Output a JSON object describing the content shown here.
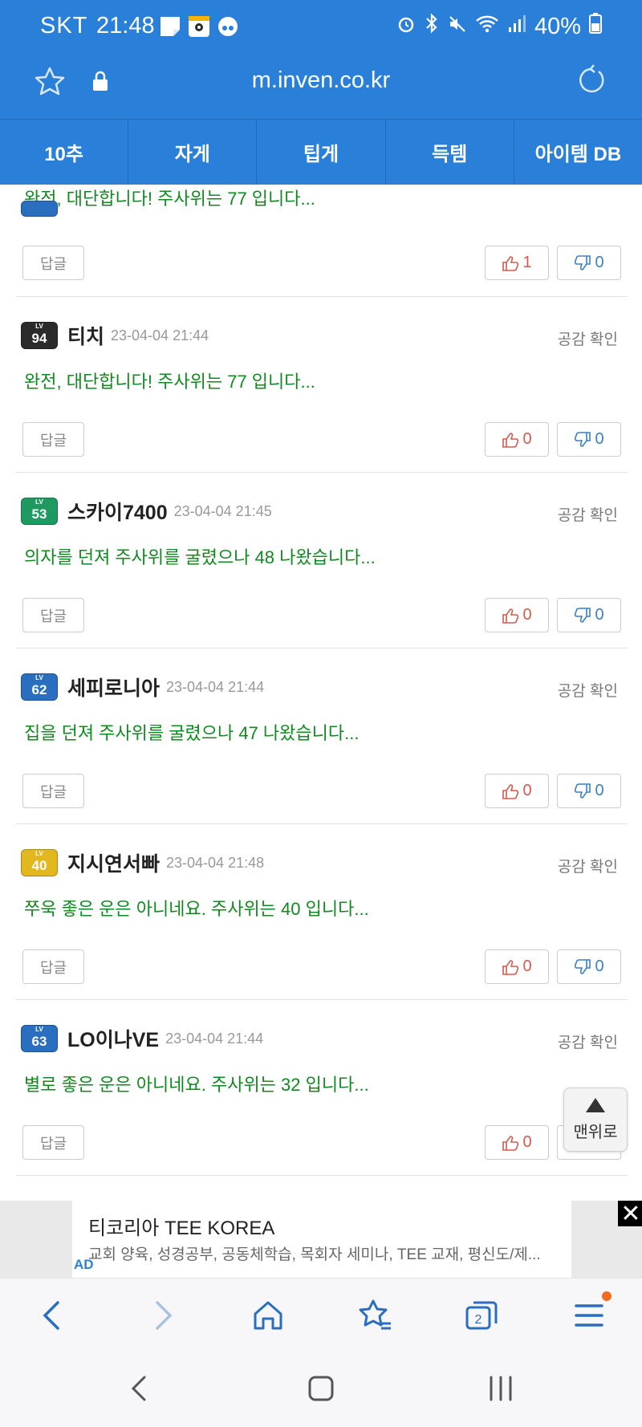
{
  "status": {
    "carrier": "SKT",
    "time": "21:48",
    "battery": "40%"
  },
  "browser": {
    "url": "m.inven.co.kr"
  },
  "tabs": [
    {
      "label": "10추"
    },
    {
      "label": "자게"
    },
    {
      "label": "팁게"
    },
    {
      "label": "득템"
    },
    {
      "label": "아이템 DB"
    }
  ],
  "comments": [
    {
      "text": "완전, 대단합니다! 주사위는 77 입니다...",
      "reply": "답글",
      "up": "1",
      "down": "0",
      "partial": true
    },
    {
      "level": "94",
      "badge_color": "#2b2b2b",
      "nick": "티치",
      "date": "23-04-04 21:44",
      "empathy": "공감 확인",
      "text": "완전, 대단합니다! 주사위는 77 입니다...",
      "reply": "답글",
      "up": "0",
      "down": "0"
    },
    {
      "level": "53",
      "badge_color": "#1e9a61",
      "nick": "스카이7400",
      "date": "23-04-04 21:45",
      "empathy": "공감 확인",
      "text": "의자를 던져 주사위를 굴렸으나 48 나왔습니다...",
      "reply": "답글",
      "up": "0",
      "down": "0"
    },
    {
      "level": "62",
      "badge_color": "#2a6fbf",
      "nick": "세피로니아",
      "date": "23-04-04 21:44",
      "empathy": "공감 확인",
      "text": "집을 던져 주사위를 굴렸으나 47 나왔습니다...",
      "reply": "답글",
      "up": "0",
      "down": "0"
    },
    {
      "level": "40",
      "badge_color": "#e3b81f",
      "nick": "지시연서빠",
      "date": "23-04-04 21:48",
      "empathy": "공감 확인",
      "text": "쭈욱 좋은 운은 아니네요. 주사위는 40 입니다...",
      "reply": "답글",
      "up": "0",
      "down": "0"
    },
    {
      "level": "63",
      "badge_color": "#2a6fbf",
      "nick": "LO이나VE",
      "date": "23-04-04 21:44",
      "empathy": "공감 확인",
      "text": "별로 좋은 운은 아니네요. 주사위는 32 입니다...",
      "reply": "답글",
      "up": "0",
      "down": ""
    }
  ],
  "lv_label": "LV",
  "top_button": "맨위로",
  "ad": {
    "title": "티코리아 TEE KOREA",
    "desc": "교회 양육, 성경공부, 공동체학습, 목회자 세미나, TEE 교재, 평신도/제...",
    "label": "AD",
    "close": "✕"
  },
  "toolbar": {
    "tabs_count": "2"
  }
}
